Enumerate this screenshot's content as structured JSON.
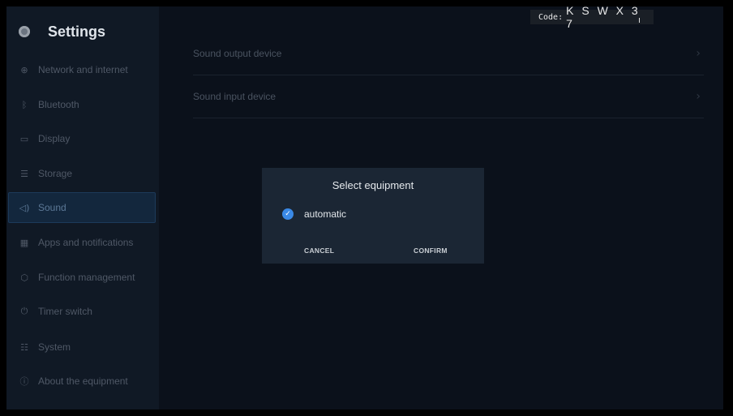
{
  "app": {
    "title": "Settings"
  },
  "code_overlay": {
    "label": "Code:",
    "value": "K S W X 3 7"
  },
  "sidebar": {
    "items": [
      {
        "label": "Network and internet",
        "icon": "globe-icon",
        "glyph": "⊕"
      },
      {
        "label": "Bluetooth",
        "icon": "bluetooth-icon",
        "glyph": "ᛒ"
      },
      {
        "label": "Display",
        "icon": "monitor-icon",
        "glyph": "▭"
      },
      {
        "label": "Storage",
        "icon": "storage-icon",
        "glyph": "☰"
      },
      {
        "label": "Sound",
        "icon": "speaker-icon",
        "glyph": "◁)",
        "active": true
      },
      {
        "label": "Apps and notifications",
        "icon": "apps-grid-icon",
        "glyph": "▦"
      },
      {
        "label": "Function management",
        "icon": "cube-icon",
        "glyph": "⬡"
      },
      {
        "label": "Timer switch",
        "icon": "power-icon",
        "glyph": "⏻"
      },
      {
        "label": "System",
        "icon": "sliders-icon",
        "glyph": "☷"
      },
      {
        "label": "About the equipment",
        "icon": "info-icon",
        "glyph": "ⓘ"
      }
    ]
  },
  "main": {
    "rows": [
      {
        "label": "Sound output device",
        "chevron": "›"
      },
      {
        "label": "Sound input device",
        "chevron": "›"
      }
    ]
  },
  "dialog": {
    "title": "Select equipment",
    "option_label": "automatic",
    "option_checked": true,
    "check_glyph": "✓",
    "cancel_label": "CANCEL",
    "confirm_label": "CONFIRM"
  },
  "colors": {
    "accent": "#3a89e6",
    "background": "#0b111b",
    "sidebar": "#101925",
    "dialog": "#1b2634"
  }
}
